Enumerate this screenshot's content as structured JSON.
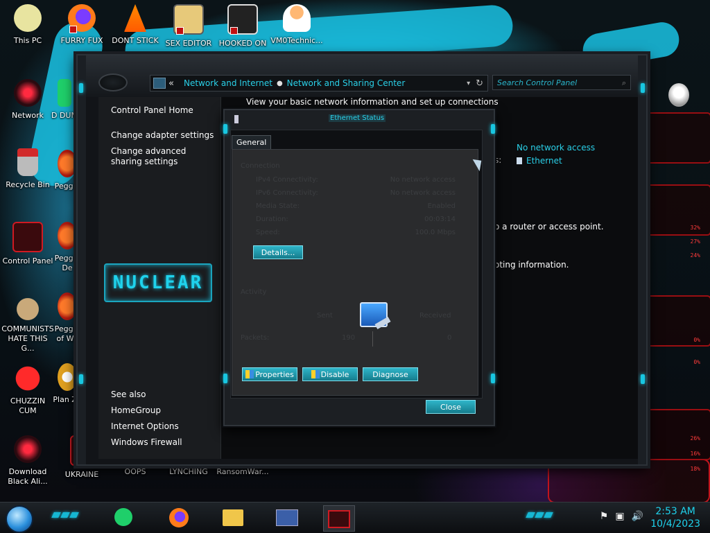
{
  "desktop": {
    "icons_top": [
      {
        "label": "This PC",
        "icon": "computer-icon"
      },
      {
        "label": "FURRY FUX",
        "icon": "firefox-icon"
      },
      {
        "label": "DONT STICK",
        "icon": "vlc-cone-icon"
      },
      {
        "label": "SEX EDITOR",
        "icon": "hxd-editor-icon"
      },
      {
        "label": "HOOKED ON",
        "icon": "game-icon"
      },
      {
        "label": "VM0Technic...",
        "icon": "doctor-avatar-icon"
      }
    ],
    "icons_left": [
      {
        "label": "Network",
        "icon": "network-orb-icon"
      },
      {
        "label": "Recycle Bin",
        "icon": "recycle-bin-icon"
      },
      {
        "label": "Control Panel",
        "icon": "control-panel-icon"
      },
      {
        "label": "COMMUNISTS HATE THIS G...",
        "icon": "money-bag-icon"
      },
      {
        "label": "CHUZZIN CUM",
        "icon": "chuzzle-icon"
      },
      {
        "label": "Download Black Ali...",
        "icon": "alien-orb-icon"
      }
    ],
    "icons_col2": [
      {
        "label": "D DUM",
        "icon": "app-icon"
      },
      {
        "label": "Peggle",
        "icon": "peggle-icon"
      },
      {
        "label": "Peggle De",
        "icon": "peggle-icon"
      },
      {
        "label": "Peggle of Wa",
        "icon": "peggle-icon"
      },
      {
        "label": "Plan Zo",
        "icon": "flower-icon"
      }
    ],
    "icons_bottom": [
      {
        "label": "UKRAINE"
      },
      {
        "label": "OOPS"
      },
      {
        "label": "LYNCHING"
      },
      {
        "label": "RansomWar..."
      }
    ]
  },
  "window": {
    "breadcrumb": [
      "Network and Internet",
      "Network and Sharing Center"
    ],
    "back_symbol": "«",
    "search_placeholder": "Search Control Panel",
    "left_links": [
      "Control Panel Home",
      "Change adapter settings",
      "Change advanced sharing settings"
    ],
    "see_also_title": "See also",
    "see_also": [
      "HomeGroup",
      "Internet Options",
      "Windows Firewall"
    ],
    "logo_text": "NUCLEAR",
    "heading": "View your basic network information and set up connections",
    "access_type": "No network access",
    "connection": "Ethernet",
    "colon_fragment": "s:",
    "text_router": "o a router or access point.",
    "text_troubleshoot": "oting information."
  },
  "dialog": {
    "title": "Ethernet Status",
    "tab": "General",
    "connection_group": "Connection",
    "rows": [
      {
        "label": "IPv4 Connectivity:",
        "value": "No network access"
      },
      {
        "label": "IPv6 Connectivity:",
        "value": "No network access"
      },
      {
        "label": "Media State:",
        "value": "Enabled"
      },
      {
        "label": "Duration:",
        "value": "00:03:14"
      },
      {
        "label": "Speed:",
        "value": "100.0 Mbps"
      }
    ],
    "details_btn": "Details...",
    "activity_group": "Activity",
    "sent_label": "Sent",
    "received_label": "Received",
    "packets_label": "Packets:",
    "packets_sent": "190",
    "packets_received": "0",
    "properties_btn": "Properties",
    "disable_btn": "Disable",
    "diagnose_btn": "Diagnose",
    "close_btn": "Close"
  },
  "right_panel": {
    "percents": [
      "32%",
      "27%",
      "24%",
      "0%",
      "0%",
      "26%",
      "16%",
      "18%"
    ]
  },
  "taskbar": {
    "pinned": [
      "notes-app-icon",
      "firefox-icon",
      "file-explorer-icon",
      "control-panel-icon",
      "network-app-icon"
    ],
    "time": "2:53 AM",
    "date": "10/4/2023"
  },
  "colors": {
    "accent_cyan": "#1fd2ec",
    "accent_red": "#c2141c",
    "window_bg": "#121418"
  }
}
